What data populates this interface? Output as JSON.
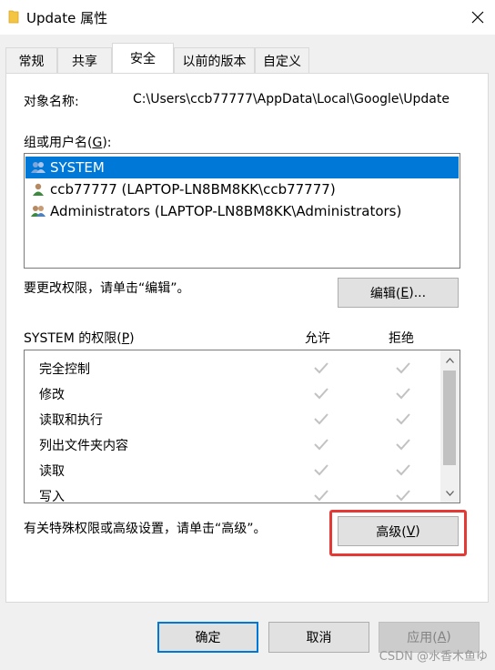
{
  "window": {
    "title": "Update 属性",
    "close_icon": "close-icon"
  },
  "tabs": [
    {
      "label": "常规",
      "active": false
    },
    {
      "label": "共享",
      "active": false
    },
    {
      "label": "安全",
      "active": true
    },
    {
      "label": "以前的版本",
      "active": false
    },
    {
      "label": "自定义",
      "active": false
    }
  ],
  "security": {
    "object_label": "对象名称:",
    "object_value": "C:\\Users\\ccb77777\\AppData\\Local\\Google\\Update",
    "group_label_pre": "组或用户名(",
    "group_label_key": "G",
    "group_label_post": "):",
    "users": [
      {
        "name": "SYSTEM",
        "icon": "group-users-icon",
        "selected": true
      },
      {
        "name": "ccb77777 (LAPTOP-LN8BM8KK\\ccb77777)",
        "icon": "user-icon",
        "selected": false
      },
      {
        "name": "Administrators (LAPTOP-LN8BM8KK\\Administrators)",
        "icon": "group-users-icon",
        "selected": false
      }
    ],
    "edit_hint": "要更改权限，请单击“编辑”。",
    "edit_button_pre": "编辑(",
    "edit_button_key": "E",
    "edit_button_post": ")...",
    "perm_label_pre": "SYSTEM 的权限(",
    "perm_label_key": "P",
    "perm_label_post": ")",
    "allow_header": "允许",
    "deny_header": "拒绝",
    "permissions": [
      {
        "name": "完全控制",
        "allow": true,
        "deny": true
      },
      {
        "name": "修改",
        "allow": true,
        "deny": true
      },
      {
        "name": "读取和执行",
        "allow": true,
        "deny": true
      },
      {
        "name": "列出文件夹内容",
        "allow": true,
        "deny": true
      },
      {
        "name": "读取",
        "allow": true,
        "deny": true
      },
      {
        "name": "写入",
        "allow": true,
        "deny": true
      }
    ],
    "advanced_hint": "有关特殊权限或高级设置，请单击“高级”。",
    "advanced_button_pre": "高级(",
    "advanced_button_key": "V",
    "advanced_button_post": ")"
  },
  "footer": {
    "ok_label": "确定",
    "cancel_label": "取消",
    "apply_label_pre": "应用(",
    "apply_label_key": "A",
    "apply_label_post": ")"
  },
  "watermark": "CSDN @水香木鱼ゆ",
  "colors": {
    "selection": "#0078d7",
    "highlight_border": "#e53935",
    "checkmark": "#c2c2c2"
  }
}
